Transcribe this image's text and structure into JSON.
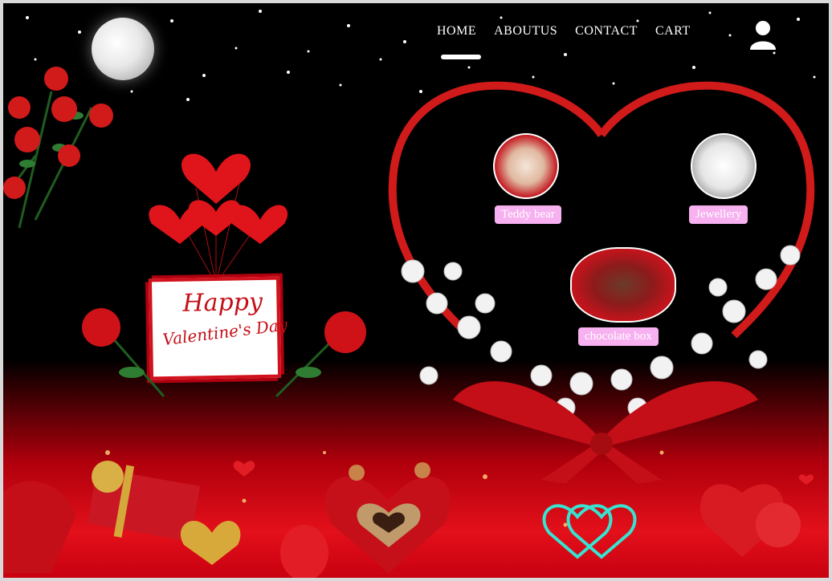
{
  "nav": {
    "items": [
      "HOME",
      "ABOUTUS",
      "CONTACT",
      "CART"
    ],
    "active": "HOME"
  },
  "icons": {
    "user": "user-icon",
    "moon": "moon-illustration",
    "card": "valentine-card"
  },
  "card": {
    "line1": "Happy",
    "line2": "Valentine's Day"
  },
  "products": [
    {
      "label": "Teddy bear"
    },
    {
      "label": "Jewellery"
    },
    {
      "label": "chocolate box"
    }
  ],
  "colors": {
    "accent_red": "#d1121c",
    "label_bg": "#f7b0f0",
    "background_top": "#000000",
    "background_bottom": "#e3101a"
  }
}
